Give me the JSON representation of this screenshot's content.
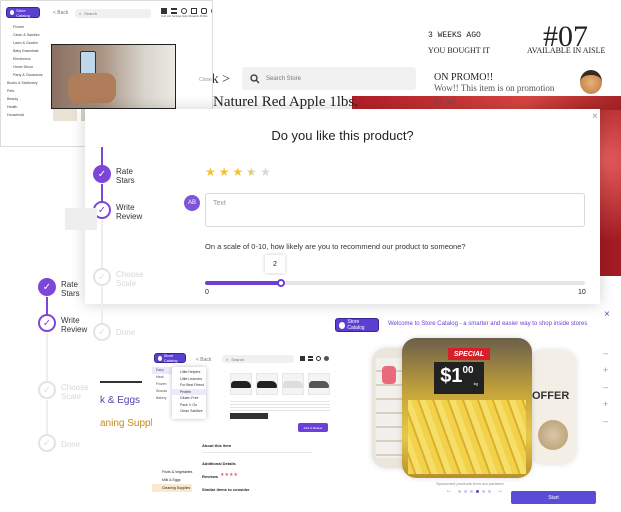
{
  "thumb_topleft": {
    "brand": "Store Catalog",
    "back_label": "< Back",
    "search_placeholder": "Search",
    "toolbar_labels": [
      "Grid",
      "List",
      "Settings",
      "Help",
      "Rewards",
      "Profile"
    ],
    "side_items": [
      "Frozen",
      "Clean & Sanitize",
      "Lawn & Garden",
      "Baby Essentials",
      "Electronics",
      "Home Décor",
      "Party & Occasions",
      "Books & Stationery"
    ],
    "side_sections": [
      "Pets",
      "Beauty",
      "Health",
      "Household"
    ],
    "chat_label": "Close"
  },
  "header": {
    "back_label": "< Back",
    "search_placeholder": "Search Store",
    "product_title": "Naturel Red Apple 1lbs.",
    "weeks_ago": "3 WEEKS AGO",
    "you_bought": "YOU BOUGHT IT",
    "aisle_number": "#07",
    "aisle_label": "AVAILABLE IN AISLE",
    "promo_title": "ON PROMO!!",
    "promo_text": "Wow!! This item is on promotion",
    "promo_price": "$2 off"
  },
  "dialog": {
    "question": "Do you like this product?",
    "rating": 3.5,
    "avatar_initials": "AB",
    "text_placeholder": "Text",
    "nps_question": "On a scale of 0-10, how likely are you to recommend our product to someone?",
    "nps_value": "2",
    "nps_min": "0",
    "nps_max": "10",
    "nps_fraction": 0.2,
    "close_label": "×"
  },
  "steps_top": [
    {
      "label_1": "Rate",
      "label_2": "Stars"
    },
    {
      "label_1": "Write",
      "label_2": "Review"
    },
    {
      "label_1": "Choose",
      "label_2": "Scale"
    },
    {
      "label_1": "Done",
      "label_2": ""
    }
  ],
  "steps_bottom": [
    {
      "label_1": "Rate",
      "label_2": "Stars"
    },
    {
      "label_1": "Write",
      "label_2": "Review"
    },
    {
      "label_1": "Choose",
      "label_2": "Scale"
    },
    {
      "label_1": "Done",
      "label_2": ""
    }
  ],
  "fragments": {
    "eggs": "k & Eggs",
    "supplies": "aning Supplie"
  },
  "thumb_bottom": {
    "brand": "Store Catalog",
    "back_label": "< Back",
    "search_placeholder": "Search",
    "dropdown_items": [
      "Little Helpers",
      "Little Learners",
      "For Best Friend",
      "Protein",
      "Gluten Free",
      "Pack 'n Go",
      "Clean Sanitize"
    ],
    "side_items": [
      "Dairy",
      "Meat",
      "Frozen",
      "Snacks",
      "Bakery"
    ],
    "about_title": "About this item",
    "additional_title": "Additional Details",
    "reviews_label": "Reviews",
    "similar_title": "Similar items to consider",
    "cta_label": "Add to Basket",
    "bottom_tags": [
      "Fruits & Vegetables",
      "Milk & Eggs",
      "Cleaning Supplies"
    ]
  },
  "promo_panel": {
    "brand": "Store Catalog",
    "banner": "Welcome to Store Catalog - a smarter and easier way to shop inside stores",
    "special_label": "SPECIAL",
    "price_main": "$1",
    "price_cents": "00",
    "price_unit": "kg",
    "offer_text": "OFFER",
    "caption": "Sponsored products from our partners",
    "start_label": "Start",
    "close_label": "×",
    "carousel_count": 6,
    "carousel_active": 3
  },
  "colors": {
    "accent": "#6c3fd8",
    "star": "#f4c430",
    "brand": "#5b3fd0",
    "apple_red": "#c2262e"
  }
}
